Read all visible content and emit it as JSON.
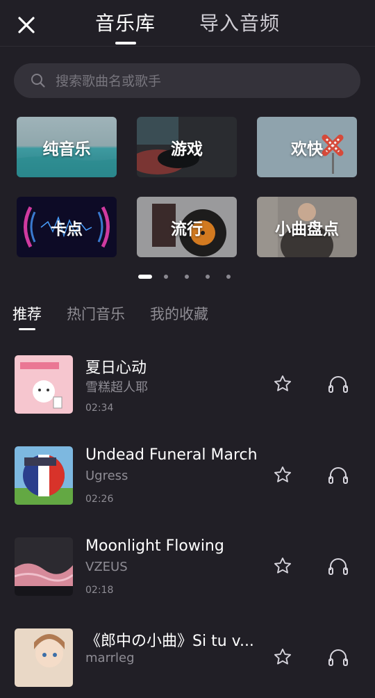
{
  "header": {
    "tabs": [
      {
        "label": "音乐库",
        "active": true
      },
      {
        "label": "导入音频",
        "active": false
      }
    ]
  },
  "search": {
    "placeholder": "搜索歌曲名或歌手"
  },
  "categories": [
    {
      "label": "纯音乐"
    },
    {
      "label": "游戏"
    },
    {
      "label": "欢快"
    },
    {
      "label": "卡点"
    },
    {
      "label": "流行"
    },
    {
      "label": "小曲盘点"
    }
  ],
  "carousel": {
    "pages": 5,
    "active_page": 1
  },
  "sub_tabs": [
    {
      "label": "推荐",
      "active": true
    },
    {
      "label": "热门音乐",
      "active": false
    },
    {
      "label": "我的收藏",
      "active": false
    }
  ],
  "songs": [
    {
      "title": "夏日心动",
      "artist": "雪糕超人耶",
      "duration": "02:34"
    },
    {
      "title": "Undead Funeral March",
      "artist": "Ugress",
      "duration": "02:26"
    },
    {
      "title": "Moonlight Flowing",
      "artist": "VZEUS",
      "duration": "02:18"
    },
    {
      "title": "《郎中の小曲》Si tu v...",
      "artist": "marrleg",
      "duration": ""
    }
  ],
  "icons": {
    "close": "close-icon",
    "search": "search-icon",
    "favorite": "star-outline-icon",
    "preview": "headphones-icon"
  },
  "colors": {
    "background": "#211f26",
    "search_bg": "#34323a",
    "muted_text": "#8f8d95"
  }
}
